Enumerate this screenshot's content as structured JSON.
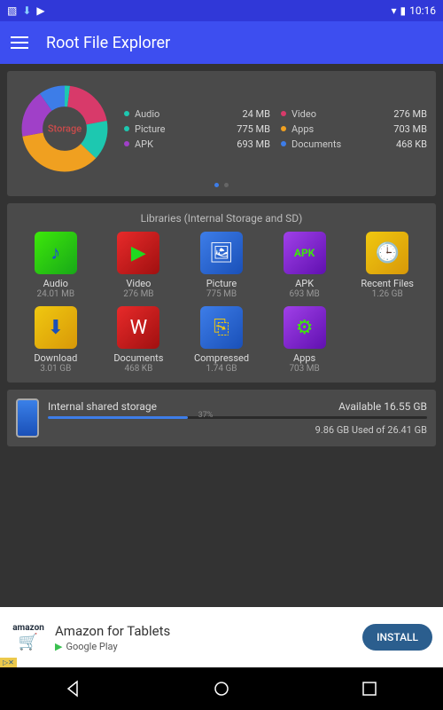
{
  "statusbar": {
    "time": "10:16"
  },
  "appbar": {
    "title": "Root File Explorer"
  },
  "donut": {
    "center_label": "Storage",
    "slices": [
      {
        "name": "Audio",
        "color": "#1dc8b0",
        "pct": 0.02
      },
      {
        "name": "Video",
        "color": "#d83a6a",
        "pct": 0.2
      },
      {
        "name": "Picture",
        "color": "#1dc8b0",
        "pct": 0.15
      },
      {
        "name": "Apps",
        "color": "#f0a020",
        "pct": 0.35
      },
      {
        "name": "APK",
        "color": "#a040c8",
        "pct": 0.18
      },
      {
        "name": "Documents",
        "color": "#3d7de8",
        "pct": 0.1
      }
    ]
  },
  "legend": [
    {
      "name": "Audio",
      "value": "24 MB",
      "color": "#1dc8b0"
    },
    {
      "name": "Video",
      "value": "276 MB",
      "color": "#d83a6a"
    },
    {
      "name": "Picture",
      "value": "775 MB",
      "color": "#1dc8b0"
    },
    {
      "name": "Apps",
      "value": "703 MB",
      "color": "#f0a020"
    },
    {
      "name": "APK",
      "value": "693 MB",
      "color": "#a040c8"
    },
    {
      "name": "Documents",
      "value": "468 KB",
      "color": "#3d7de8"
    }
  ],
  "libraries": {
    "title": "Libraries (Internal Storage and SD)",
    "items": [
      {
        "name": "Audio",
        "size": "24.01 MB",
        "bg": "linear-gradient(135deg,#3de80a,#18a818)",
        "glyph": "♪",
        "fg": "#1a4fd8"
      },
      {
        "name": "Video",
        "size": "276 MB",
        "bg": "linear-gradient(135deg,#e82a2a,#a01010)",
        "glyph": "▶",
        "fg": "#20d820"
      },
      {
        "name": "Picture",
        "size": "775 MB",
        "bg": "linear-gradient(135deg,#3d7de8,#1a50b8)",
        "glyph": "🖼",
        "fg": "#fff"
      },
      {
        "name": "APK",
        "size": "693 MB",
        "bg": "linear-gradient(135deg,#a040e8,#6010b0)",
        "glyph": "APK",
        "fg": "#3de80a"
      },
      {
        "name": "Recent Files",
        "size": "1.26 GB",
        "bg": "linear-gradient(135deg,#f0c810,#d89808)",
        "glyph": "🕒",
        "fg": "#1a50b8"
      },
      {
        "name": "Download",
        "size": "3.01 GB",
        "bg": "linear-gradient(135deg,#f0c810,#d89808)",
        "glyph": "⬇",
        "fg": "#1a50b8"
      },
      {
        "name": "Documents",
        "size": "468 KB",
        "bg": "linear-gradient(135deg,#e82a2a,#a01010)",
        "glyph": "W",
        "fg": "#fff"
      },
      {
        "name": "Compressed",
        "size": "1.74 GB",
        "bg": "linear-gradient(135deg,#3d7de8,#1a50b8)",
        "glyph": "⎘",
        "fg": "#f0c810"
      },
      {
        "name": "Apps",
        "size": "703 MB",
        "bg": "linear-gradient(135deg,#a040e8,#6010b0)",
        "glyph": "⚙",
        "fg": "#3de80a"
      }
    ]
  },
  "internal": {
    "name": "Internal shared storage",
    "available": "Available 16.55 GB",
    "percent": 37,
    "percent_label": "37%",
    "used": "9.86 GB Used of 26.41 GB"
  },
  "ad": {
    "brand": "amazon",
    "title": "Amazon for Tablets",
    "sub": "Google Play",
    "cta": "INSTALL",
    "badge": "▷✕"
  }
}
